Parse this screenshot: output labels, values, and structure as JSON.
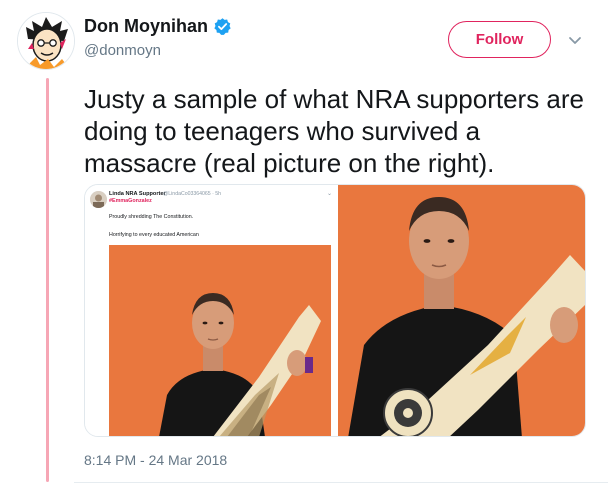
{
  "author": {
    "display_name": "Don Moynihan",
    "handle": "@donmoyn",
    "verified": true,
    "avatar_icon": "cartoon-avatar-icon"
  },
  "follow_label": "Follow",
  "menu_icon": "chevron-down-icon",
  "tweet_text": "Justy a sample of what NRA supporters are doing to teenagers who survived a massacre (real picture on the right).",
  "timestamp": "8:14 PM - 24 Mar 2018",
  "embedded_tweet": {
    "name": "Linda NRA Supporter",
    "handle": "@LindaCo03364065 · 5h",
    "hashtag": "#EmmaGonzalez",
    "line1": "Proudly shredding The Constitution.",
    "line2": "Horrifying to every educated American"
  },
  "colors": {
    "accent": "#e0245e",
    "verified_blue": "#1da1f2",
    "thread_line": "#f6a6b5",
    "muted_text": "#657786",
    "photo_background": "#e9773e"
  }
}
